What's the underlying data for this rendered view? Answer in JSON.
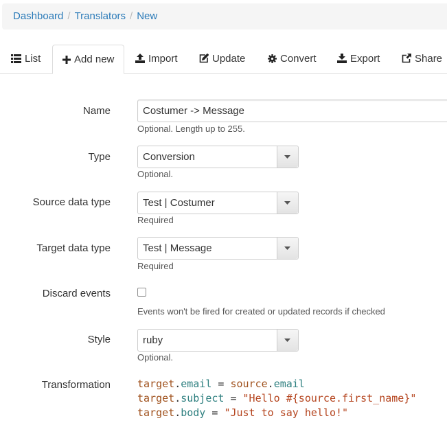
{
  "breadcrumb": {
    "items": [
      "Dashboard",
      "Translators"
    ],
    "active": "New",
    "separator": "/"
  },
  "tabs": [
    {
      "label": "List",
      "icon": "list-icon"
    },
    {
      "label": "Add new",
      "icon": "plus-icon"
    },
    {
      "label": "Import",
      "icon": "upload-icon"
    },
    {
      "label": "Update",
      "icon": "edit-icon"
    },
    {
      "label": "Convert",
      "icon": "gear-icon"
    },
    {
      "label": "Export",
      "icon": "download-icon"
    },
    {
      "label": "Share",
      "icon": "share-icon"
    }
  ],
  "form": {
    "name": {
      "label": "Name",
      "value": "Costumer -> Message",
      "help": "Optional. Length up to 255."
    },
    "type": {
      "label": "Type",
      "value": "Conversion",
      "help": "Optional."
    },
    "source": {
      "label": "Source data type",
      "value": "Test | Costumer",
      "help": "Required"
    },
    "target": {
      "label": "Target data type",
      "value": "Test | Message",
      "help": "Required"
    },
    "discard": {
      "label": "Discard events",
      "checked": false,
      "help": "Events won't be fired for created or updated records if checked"
    },
    "style": {
      "label": "Style",
      "value": "ruby",
      "help": "Optional."
    },
    "transformation": {
      "label": "Transformation",
      "lines": [
        {
          "obj": "target",
          "attr": "email",
          "op": "=",
          "rhs_obj": "source",
          "rhs_attr": "email"
        },
        {
          "obj": "target",
          "attr": "subject",
          "op": "=",
          "str": "\"Hello #{source.first_name}\""
        },
        {
          "obj": "target",
          "attr": "body",
          "op": "=",
          "str": "\"Just to say hello!\""
        }
      ]
    }
  },
  "colors": {
    "link": "#2a7ab8",
    "code_var": "#a0521e",
    "code_attr": "#2f8080",
    "code_string": "#b5451f"
  }
}
